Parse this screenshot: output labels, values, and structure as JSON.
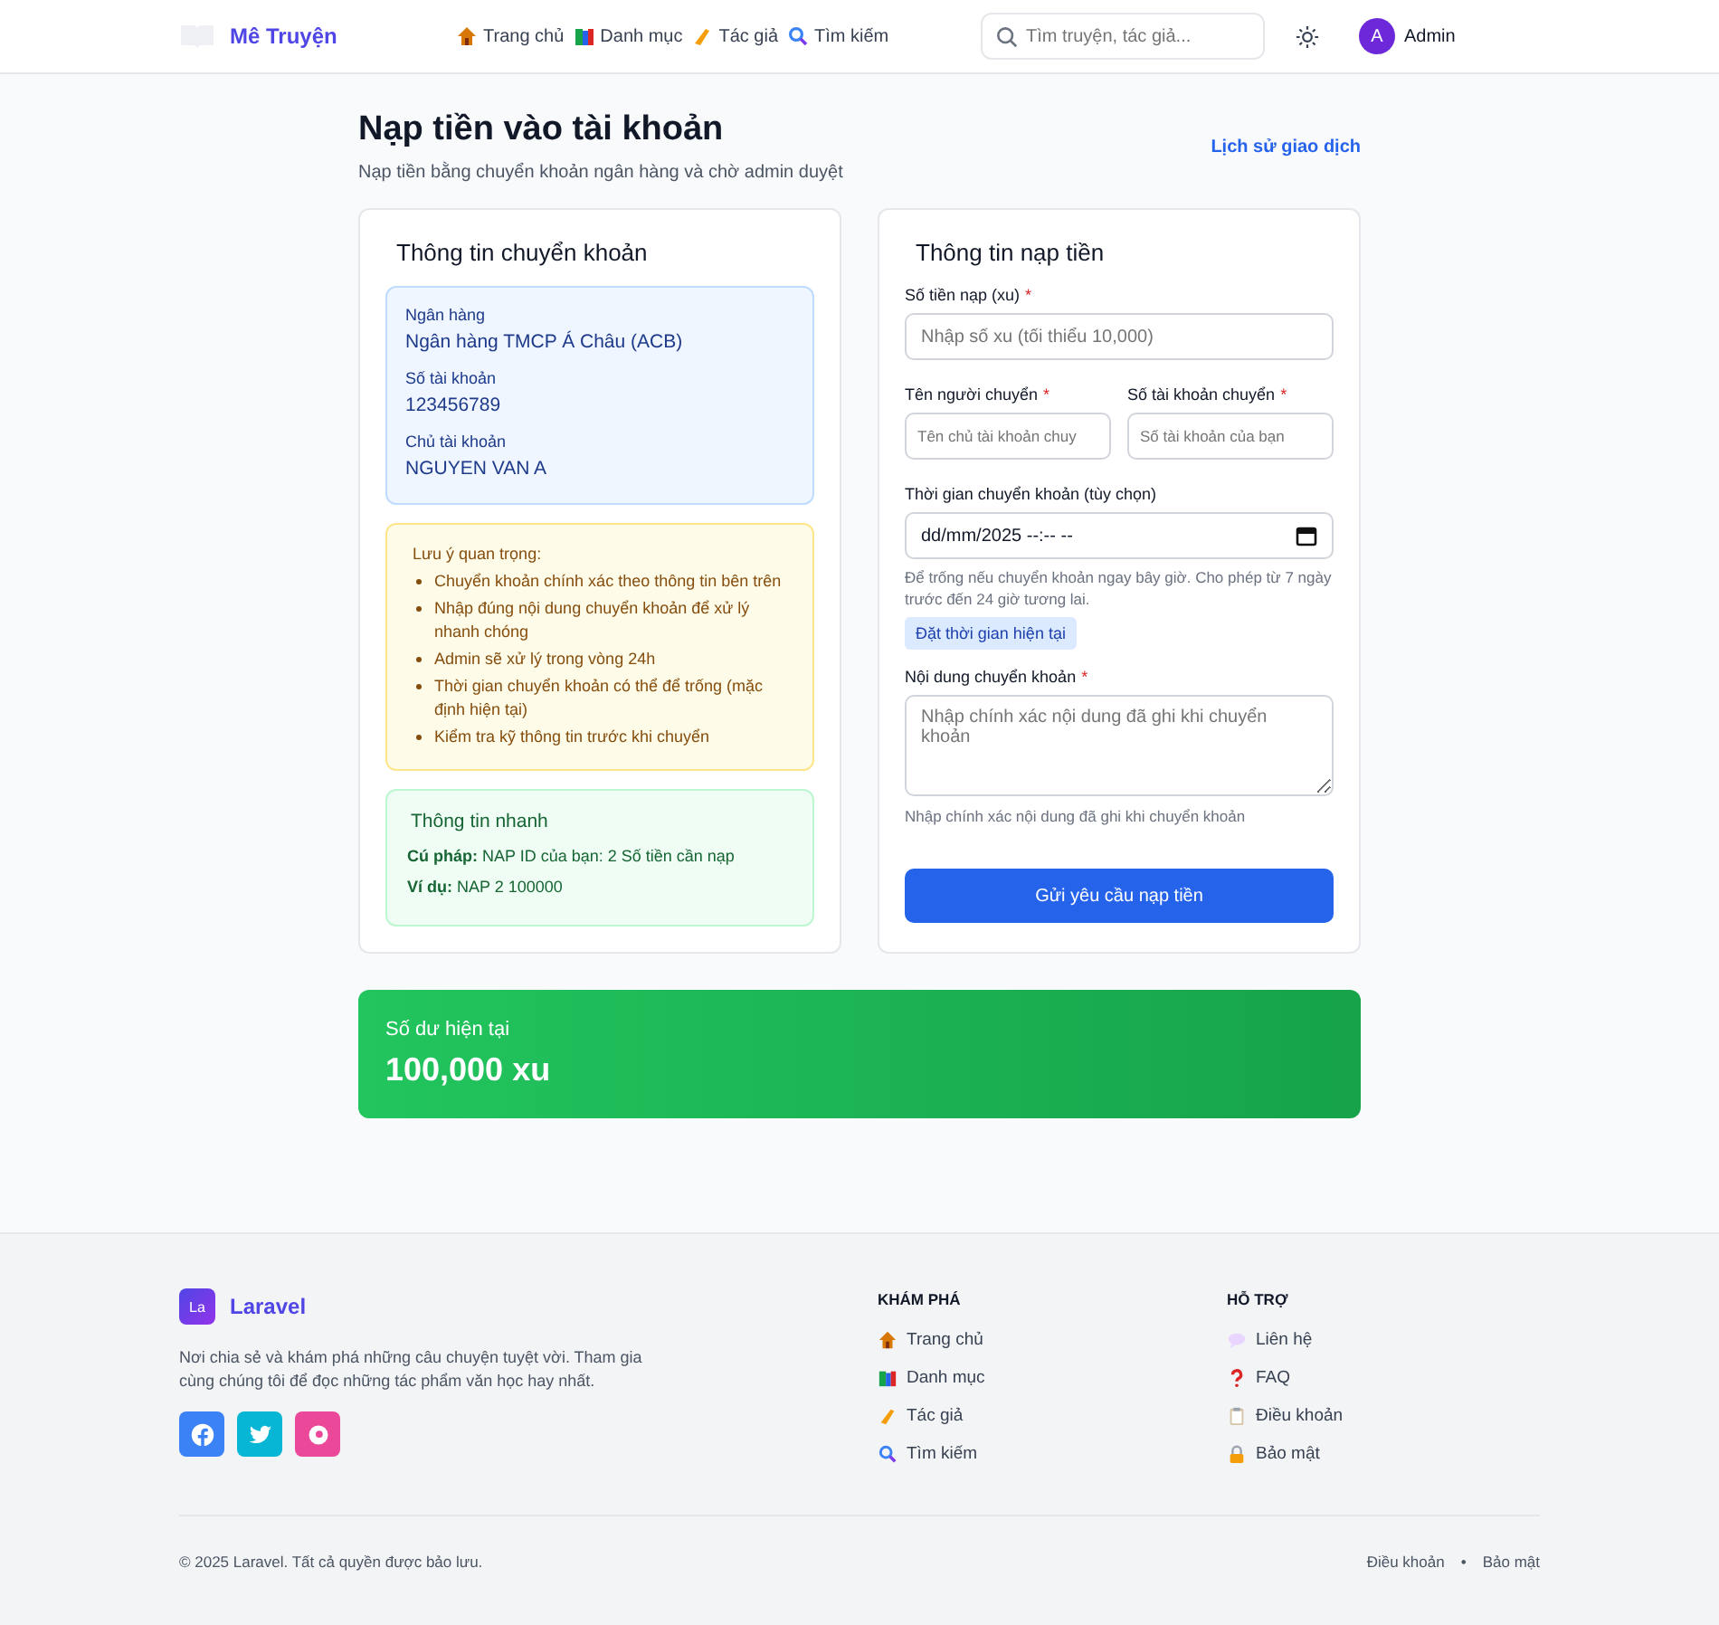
{
  "header": {
    "logo": "Mê Truyện",
    "nav": [
      {
        "label": "Trang chủ",
        "kind": "home"
      },
      {
        "label": "Danh mục",
        "kind": "books"
      },
      {
        "label": "Tác giả",
        "kind": "writing"
      },
      {
        "label": "Tìm kiếm",
        "kind": "search"
      }
    ],
    "search": {
      "placeholder": "Tìm truyện, tác giả..."
    },
    "user": {
      "initial": "A",
      "name": "Admin"
    }
  },
  "page": {
    "title": "Nạp tiền vào tài khoản",
    "subtitle": "Nạp tiền bằng chuyển khoản ngân hàng và chờ admin duyệt",
    "history_link": "Lịch sử giao dịch"
  },
  "transfer_info": {
    "title": "Thông tin chuyển khoản",
    "fields": [
      {
        "label": "Ngân hàng",
        "value": "Ngân hàng TMCP Á Châu (ACB)"
      },
      {
        "label": "Số tài khoản",
        "value": "123456789"
      },
      {
        "label": "Chủ tài khoản",
        "value": "NGUYEN VAN A"
      }
    ],
    "notice": {
      "title": "Lưu ý quan trọng:",
      "items": [
        "Chuyển khoản chính xác theo thông tin bên trên",
        "Nhập đúng nội dung chuyển khoản để xử lý nhanh chóng",
        "Admin sẽ xử lý trong vòng 24h",
        "Thời gian chuyển khoản có thể để trống (mặc định hiện tại)",
        "Kiểm tra kỹ thông tin trước khi chuyển"
      ]
    },
    "quick": {
      "title": "Thông tin nhanh",
      "lines": [
        "**Cú pháp:** NAP ID của bạn: 2 Số tiền cần nạp",
        "**Ví dụ:** NAP 2 100000"
      ]
    }
  },
  "deposit_form": {
    "title": "Thông tin nạp tiền",
    "amount": {
      "label": "Số tiền nạp (xu)",
      "required_mark": "*",
      "placeholder": "Nhập số xu (tối thiểu 10,000)"
    },
    "sender_name": {
      "label": "Tên người chuyển",
      "required_mark": "*",
      "placeholder": "Tên chủ tài khoản chuy"
    },
    "sender_account": {
      "label": "Số tài khoản chuyển",
      "required_mark": "*",
      "placeholder": "Số tài khoản của bạn"
    },
    "time": {
      "label": "Thời gian chuyển khoản (tùy chọn)",
      "value": "dd/mm/2025 --:-- --",
      "hint": "Để trống nếu chuyển khoản ngay bây giờ. Cho phép từ 7 ngày trước đến 24 giờ tương lai.",
      "now_button": "Đặt thời gian hiện tại"
    },
    "content": {
      "label": "Nội dung chuyển khoản",
      "required_mark": "*",
      "placeholder": "Nhập chính xác nội dung đã ghi khi chuyển khoản",
      "hint": "Nhập chính xác nội dung đã ghi khi chuyển khoản"
    },
    "submit": "Gửi yêu cầu nạp tiền"
  },
  "balance": {
    "label": "Số dư hiện tại",
    "value": "100,000 xu"
  },
  "footer": {
    "logo_mark": "La",
    "brand": "Laravel",
    "description": "Nơi chia sẻ và khám phá những câu chuyện tuyệt vời. Tham gia cùng chúng tôi để đọc những tác phẩm văn học hay nhất.",
    "social": [
      {
        "kind": "facebook",
        "color": "#3b82f6"
      },
      {
        "kind": "twitter",
        "color": "#06b6d4"
      },
      {
        "kind": "instagram",
        "color": "#ec4899"
      }
    ],
    "columns": [
      {
        "title": "KHÁM PHÁ",
        "links": [
          {
            "label": "Trang chủ",
            "kind": "home"
          },
          {
            "label": "Danh mục",
            "kind": "books"
          },
          {
            "label": "Tác giả",
            "kind": "writing"
          },
          {
            "label": "Tìm kiếm",
            "kind": "search"
          }
        ]
      },
      {
        "title": "HỖ TRỢ",
        "links": [
          {
            "label": "Liên hệ",
            "kind": "speech"
          },
          {
            "label": "FAQ",
            "kind": "question"
          },
          {
            "label": "Điều khoản",
            "kind": "clipboard"
          },
          {
            "label": "Bảo mật",
            "kind": "lock"
          }
        ]
      }
    ],
    "copyright": "© 2025 Laravel. Tất cả quyền được bảo lưu.",
    "bottom_links": [
      "Điều khoản",
      "Bảo mật"
    ],
    "separator": "•"
  }
}
